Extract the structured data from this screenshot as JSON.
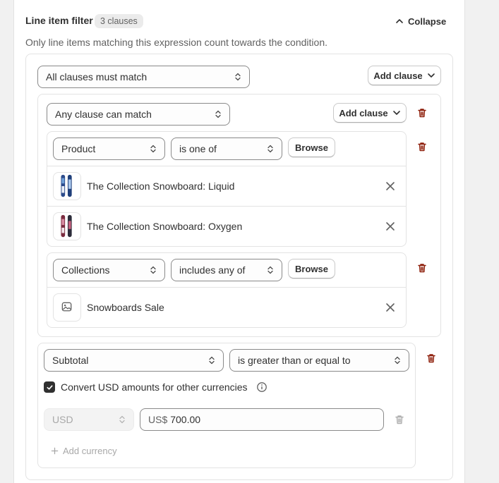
{
  "header": {
    "title": "Line item filter",
    "badge": "3 clauses",
    "collapse_label": "Collapse",
    "description": "Only line items matching this expression count towards the condition."
  },
  "outer_group": {
    "match_select": "All clauses must match",
    "add_clause_label": "Add clause"
  },
  "inner_group": {
    "match_select": "Any clause can match",
    "add_clause_label": "Add clause"
  },
  "product_clause": {
    "field_select": "Product",
    "operator_select": "is one of",
    "browse_label": "Browse",
    "items": [
      {
        "label": "The Collection Snowboard: Liquid"
      },
      {
        "label": "The Collection Snowboard: Oxygen"
      }
    ]
  },
  "collections_clause": {
    "field_select": "Collections",
    "operator_select": "includes any of",
    "browse_label": "Browse",
    "items": [
      {
        "label": "Snowboards Sale"
      }
    ]
  },
  "subtotal_clause": {
    "field_select": "Subtotal",
    "operator_select": "is greater than or equal to",
    "convert_label": "Convert USD amounts for other currencies",
    "convert_checked": true,
    "currency_select": "USD",
    "amount_prefix": "US$",
    "amount_value": "700.00",
    "add_currency_label": "Add currency"
  },
  "colors": {
    "danger": "#8e1f0b",
    "text": "#303030",
    "muted": "#616161"
  }
}
